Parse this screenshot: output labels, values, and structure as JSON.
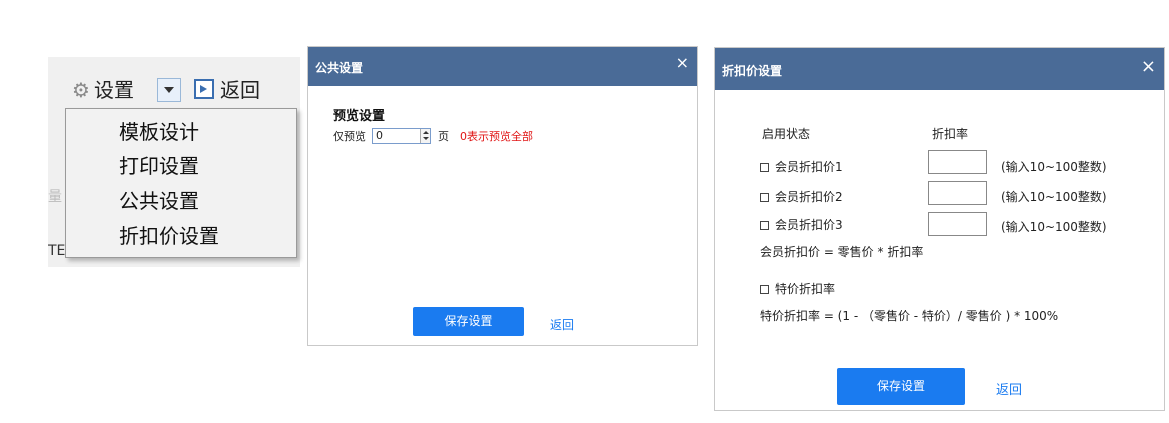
{
  "toolbar": {
    "settings_label": "设置",
    "back_label": "返回",
    "under_text": "量",
    "bottom_text": "TE",
    "menu_items": [
      "模板设计",
      "打印设置",
      "公共设置",
      "折扣价设置"
    ]
  },
  "public_dialog": {
    "title": "公共设置",
    "close": "×",
    "section_title": "预览设置",
    "preview_label": "仅预览",
    "preview_value": "0",
    "page_unit": "页",
    "hint": "0表示预览全部",
    "save_button": "保存设置",
    "back_link": "返回"
  },
  "discount_dialog": {
    "title": "折扣价设置",
    "close": "×",
    "col_status": "启用状态",
    "col_rate": "折扣率",
    "rows": [
      {
        "label": "会员折扣价1",
        "hint": "(输入10~100整数)"
      },
      {
        "label": "会员折扣价2",
        "hint": "(输入10~100整数)"
      },
      {
        "label": "会员折扣价3",
        "hint": "(输入10~100整数)"
      }
    ],
    "member_formula": "会员折扣价 = 零售价 * 折扣率",
    "special_label": "特价折扣率",
    "special_formula": "特价折扣率 = (1 - （零售价 - 特价）/ 零售价 ) * 100%",
    "save_button": "保存设置",
    "back_link": "返回"
  },
  "colors": {
    "header": "#4a6b97",
    "primary_button": "#1a7bf0",
    "warning_text": "#e01414"
  }
}
